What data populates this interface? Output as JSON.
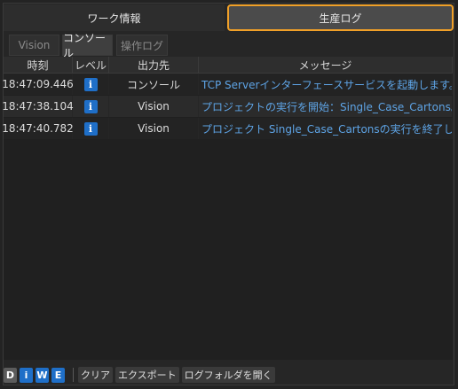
{
  "top_tabs": {
    "work_info": "ワーク情報",
    "production_log": "生産ログ"
  },
  "sub_tabs": [
    "Vision",
    "コンソール",
    "操作ログ"
  ],
  "table": {
    "headers": [
      "時刻",
      "レベル",
      "出力先",
      "メッセージ"
    ],
    "rows": [
      {
        "time": "18:47:09.446",
        "level": "i",
        "dest": "コンソール",
        "message": "TCP Serverインターフェースサービスを起動します。"
      },
      {
        "time": "18:47:38.104",
        "level": "i",
        "dest": "Vision",
        "message": "プロジェクトの実行を開始：Single_Case_Cartons。"
      },
      {
        "time": "18:47:40.782",
        "level": "i",
        "dest": "Vision",
        "message": "プロジェクト Single_Case_Cartonsの実行を終了します。"
      }
    ]
  },
  "toolbar": {
    "filters": [
      "D",
      "i",
      "W",
      "E"
    ],
    "clear": "クリア",
    "export": "エクスポート",
    "open_folder": "ログフォルダを開く"
  },
  "colors": {
    "accent": "#f0a028",
    "info_badge": "#1f6fc8",
    "message_text": "#5ea4e6"
  }
}
